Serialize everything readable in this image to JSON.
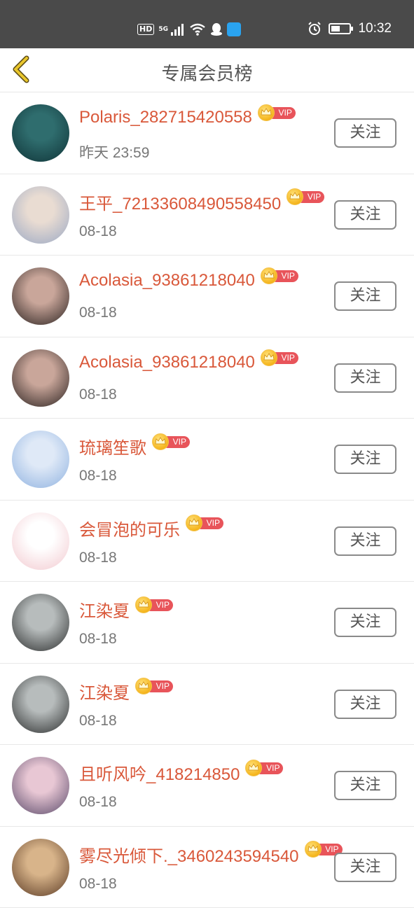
{
  "status_bar": {
    "hd_label": "HD",
    "network_label": "5G",
    "time": "10:32",
    "icons": [
      "hd-icon",
      "signal-icon",
      "wifi-icon",
      "qq-icon",
      "app-icon",
      "alarm-icon",
      "battery-icon"
    ]
  },
  "header": {
    "title": "专属会员榜",
    "back_icon": "chevron-left-icon"
  },
  "members": [
    {
      "name": "Polaris_282715420558",
      "time": "昨天 23:59",
      "vip_label": "VIP",
      "follow_label": "关注",
      "avatar_colors": [
        "#2f6d6e",
        "#0f3337"
      ]
    },
    {
      "name": "王平_72133608490558450",
      "time": "08-18",
      "vip_label": "VIP",
      "follow_label": "关注",
      "avatar_colors": [
        "#e9dcd2",
        "#9aa8c4"
      ]
    },
    {
      "name": "Acolasia_93861218040",
      "time": "08-18",
      "vip_label": "VIP",
      "follow_label": "关注",
      "avatar_colors": [
        "#c9a69a",
        "#2b2220"
      ]
    },
    {
      "name": "Acolasia_93861218040",
      "time": "08-18",
      "vip_label": "VIP",
      "follow_label": "关注",
      "avatar_colors": [
        "#c9a69a",
        "#2b2220"
      ]
    },
    {
      "name": "琉璃笙歌",
      "time": "08-18",
      "vip_label": "VIP",
      "follow_label": "关注",
      "avatar_colors": [
        "#dfe9f7",
        "#8fb2e0"
      ]
    },
    {
      "name": "会冒泡的可乐",
      "time": "08-18",
      "vip_label": "VIP",
      "follow_label": "关注",
      "avatar_colors": [
        "#ffffff",
        "#f2c9cf"
      ]
    },
    {
      "name": "江染夏",
      "time": "08-18",
      "vip_label": "VIP",
      "follow_label": "关注",
      "avatar_colors": [
        "#b7bcbc",
        "#2c2e2e"
      ]
    },
    {
      "name": "江染夏",
      "time": "08-18",
      "vip_label": "VIP",
      "follow_label": "关注",
      "avatar_colors": [
        "#b7bcbc",
        "#2c2e2e"
      ]
    },
    {
      "name": "且听风吟_418214850",
      "time": "08-18",
      "vip_label": "VIP",
      "follow_label": "关注",
      "avatar_colors": [
        "#e8c7d4",
        "#5a4a6a"
      ]
    },
    {
      "name": "雾尽光倾下._3460243594540",
      "time": "08-18",
      "vip_label": "VIP",
      "follow_label": "关注",
      "avatar_colors": [
        "#d8b48a",
        "#5b3b25"
      ]
    }
  ]
}
